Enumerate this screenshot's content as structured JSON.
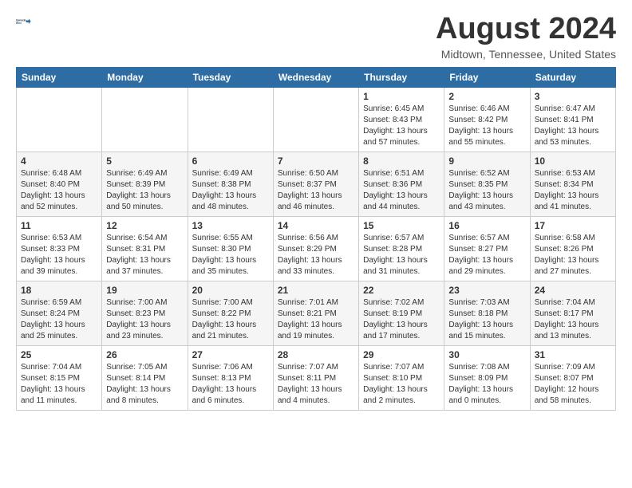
{
  "header": {
    "logo_general": "General",
    "logo_blue": "Blue",
    "month_title": "August 2024",
    "location": "Midtown, Tennessee, United States"
  },
  "weekdays": [
    "Sunday",
    "Monday",
    "Tuesday",
    "Wednesday",
    "Thursday",
    "Friday",
    "Saturday"
  ],
  "rows": [
    [
      {
        "day": "",
        "detail": ""
      },
      {
        "day": "",
        "detail": ""
      },
      {
        "day": "",
        "detail": ""
      },
      {
        "day": "",
        "detail": ""
      },
      {
        "day": "1",
        "detail": "Sunrise: 6:45 AM\nSunset: 8:43 PM\nDaylight: 13 hours\nand 57 minutes."
      },
      {
        "day": "2",
        "detail": "Sunrise: 6:46 AM\nSunset: 8:42 PM\nDaylight: 13 hours\nand 55 minutes."
      },
      {
        "day": "3",
        "detail": "Sunrise: 6:47 AM\nSunset: 8:41 PM\nDaylight: 13 hours\nand 53 minutes."
      }
    ],
    [
      {
        "day": "4",
        "detail": "Sunrise: 6:48 AM\nSunset: 8:40 PM\nDaylight: 13 hours\nand 52 minutes."
      },
      {
        "day": "5",
        "detail": "Sunrise: 6:49 AM\nSunset: 8:39 PM\nDaylight: 13 hours\nand 50 minutes."
      },
      {
        "day": "6",
        "detail": "Sunrise: 6:49 AM\nSunset: 8:38 PM\nDaylight: 13 hours\nand 48 minutes."
      },
      {
        "day": "7",
        "detail": "Sunrise: 6:50 AM\nSunset: 8:37 PM\nDaylight: 13 hours\nand 46 minutes."
      },
      {
        "day": "8",
        "detail": "Sunrise: 6:51 AM\nSunset: 8:36 PM\nDaylight: 13 hours\nand 44 minutes."
      },
      {
        "day": "9",
        "detail": "Sunrise: 6:52 AM\nSunset: 8:35 PM\nDaylight: 13 hours\nand 43 minutes."
      },
      {
        "day": "10",
        "detail": "Sunrise: 6:53 AM\nSunset: 8:34 PM\nDaylight: 13 hours\nand 41 minutes."
      }
    ],
    [
      {
        "day": "11",
        "detail": "Sunrise: 6:53 AM\nSunset: 8:33 PM\nDaylight: 13 hours\nand 39 minutes."
      },
      {
        "day": "12",
        "detail": "Sunrise: 6:54 AM\nSunset: 8:31 PM\nDaylight: 13 hours\nand 37 minutes."
      },
      {
        "day": "13",
        "detail": "Sunrise: 6:55 AM\nSunset: 8:30 PM\nDaylight: 13 hours\nand 35 minutes."
      },
      {
        "day": "14",
        "detail": "Sunrise: 6:56 AM\nSunset: 8:29 PM\nDaylight: 13 hours\nand 33 minutes."
      },
      {
        "day": "15",
        "detail": "Sunrise: 6:57 AM\nSunset: 8:28 PM\nDaylight: 13 hours\nand 31 minutes."
      },
      {
        "day": "16",
        "detail": "Sunrise: 6:57 AM\nSunset: 8:27 PM\nDaylight: 13 hours\nand 29 minutes."
      },
      {
        "day": "17",
        "detail": "Sunrise: 6:58 AM\nSunset: 8:26 PM\nDaylight: 13 hours\nand 27 minutes."
      }
    ],
    [
      {
        "day": "18",
        "detail": "Sunrise: 6:59 AM\nSunset: 8:24 PM\nDaylight: 13 hours\nand 25 minutes."
      },
      {
        "day": "19",
        "detail": "Sunrise: 7:00 AM\nSunset: 8:23 PM\nDaylight: 13 hours\nand 23 minutes."
      },
      {
        "day": "20",
        "detail": "Sunrise: 7:00 AM\nSunset: 8:22 PM\nDaylight: 13 hours\nand 21 minutes."
      },
      {
        "day": "21",
        "detail": "Sunrise: 7:01 AM\nSunset: 8:21 PM\nDaylight: 13 hours\nand 19 minutes."
      },
      {
        "day": "22",
        "detail": "Sunrise: 7:02 AM\nSunset: 8:19 PM\nDaylight: 13 hours\nand 17 minutes."
      },
      {
        "day": "23",
        "detail": "Sunrise: 7:03 AM\nSunset: 8:18 PM\nDaylight: 13 hours\nand 15 minutes."
      },
      {
        "day": "24",
        "detail": "Sunrise: 7:04 AM\nSunset: 8:17 PM\nDaylight: 13 hours\nand 13 minutes."
      }
    ],
    [
      {
        "day": "25",
        "detail": "Sunrise: 7:04 AM\nSunset: 8:15 PM\nDaylight: 13 hours\nand 11 minutes."
      },
      {
        "day": "26",
        "detail": "Sunrise: 7:05 AM\nSunset: 8:14 PM\nDaylight: 13 hours\nand 8 minutes."
      },
      {
        "day": "27",
        "detail": "Sunrise: 7:06 AM\nSunset: 8:13 PM\nDaylight: 13 hours\nand 6 minutes."
      },
      {
        "day": "28",
        "detail": "Sunrise: 7:07 AM\nSunset: 8:11 PM\nDaylight: 13 hours\nand 4 minutes."
      },
      {
        "day": "29",
        "detail": "Sunrise: 7:07 AM\nSunset: 8:10 PM\nDaylight: 13 hours\nand 2 minutes."
      },
      {
        "day": "30",
        "detail": "Sunrise: 7:08 AM\nSunset: 8:09 PM\nDaylight: 13 hours\nand 0 minutes."
      },
      {
        "day": "31",
        "detail": "Sunrise: 7:09 AM\nSunset: 8:07 PM\nDaylight: 12 hours\nand 58 minutes."
      }
    ]
  ]
}
